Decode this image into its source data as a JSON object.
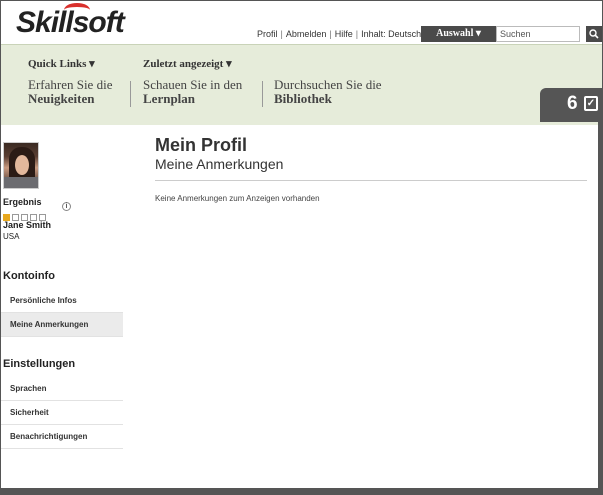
{
  "brand": {
    "logo_text": "Skillsoft"
  },
  "header": {
    "links": [
      "Profil",
      "Abmelden",
      "Hilfe",
      "Inhalt: Deutsch"
    ],
    "auswahl_label": "Auswahl ▾",
    "search_placeholder": "Suchen",
    "search_icon": "search-icon"
  },
  "nav": {
    "dropdowns": [
      "Quick Links ▾",
      "Zuletzt angezeigt ▾"
    ],
    "items": [
      {
        "line1": "Erfahren Sie die",
        "line2": "Neuigkeiten"
      },
      {
        "line1": "Schauen Sie in den",
        "line2": "Lernplan"
      },
      {
        "line1": "Durchsuchen Sie die",
        "line2": "Bibliothek"
      }
    ],
    "badge_count": "6",
    "badge_icon": "checklist-icon"
  },
  "profile": {
    "ergebnis_label": "Ergebnis",
    "score_filled": 1,
    "score_total": 5,
    "name": "Jane Smith",
    "country": "USA"
  },
  "sidebar": {
    "kontoinfo_title": "Kontoinfo",
    "kontoinfo_links": [
      "Persönliche Infos",
      "Meine Anmerkungen"
    ],
    "einstellungen_title": "Einstellungen",
    "einstellungen_links": [
      "Sprachen",
      "Sicherheit",
      "Benachrichtigungen"
    ]
  },
  "main": {
    "title": "Mein Profil",
    "subtitle": "Meine Anmerkungen",
    "empty_message": "Keine Anmerkungen zum Anzeigen vorhanden"
  }
}
